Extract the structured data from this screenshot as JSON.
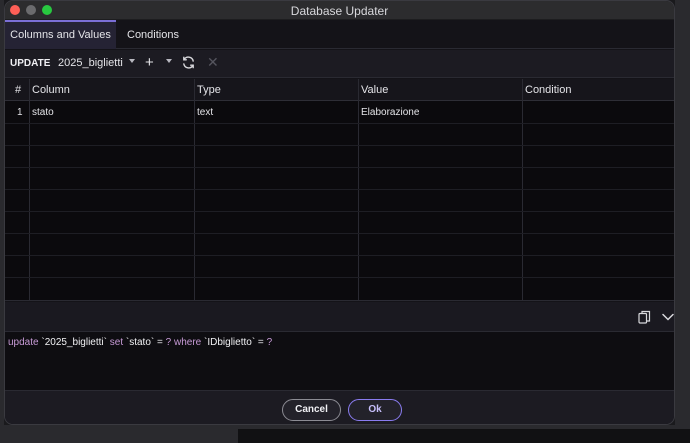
{
  "window": {
    "title": "Database Updater"
  },
  "tabs": [
    {
      "label": "Columns and Values",
      "active": true
    },
    {
      "label": "Conditions",
      "active": false
    }
  ],
  "toolbar": {
    "mode": "UPDATE",
    "table": "2025_biglietti",
    "add_icon": "plus-icon",
    "refresh_icon": "refresh-icon",
    "remove_icon": "close-icon"
  },
  "grid": {
    "headers": [
      "#",
      "Column",
      "Type",
      "Value",
      "Condition"
    ],
    "rows": [
      {
        "num": "1",
        "column": "stato",
        "type": "text",
        "value": "Elaborazione",
        "condition": ""
      }
    ]
  },
  "sql": {
    "copy_icon": "copy-icon",
    "collapse_icon": "chevron-down-icon",
    "tokens": [
      {
        "t": "update",
        "k": "kw"
      },
      {
        "t": " ",
        "k": ""
      },
      {
        "t": "`2025_biglietti`",
        "k": "id"
      },
      {
        "t": " ",
        "k": ""
      },
      {
        "t": "set",
        "k": "kw"
      },
      {
        "t": " ",
        "k": ""
      },
      {
        "t": "`stato`",
        "k": "id"
      },
      {
        "t": " = ",
        "k": ""
      },
      {
        "t": "?",
        "k": "kw"
      },
      {
        "t": " ",
        "k": ""
      },
      {
        "t": "where",
        "k": "kw"
      },
      {
        "t": " ",
        "k": ""
      },
      {
        "t": "`IDbiglietto`",
        "k": "id"
      },
      {
        "t": " = ",
        "k": ""
      },
      {
        "t": "?",
        "k": "kw"
      }
    ]
  },
  "buttons": {
    "cancel": "Cancel",
    "ok": "Ok"
  },
  "colors": {
    "accent": "#7b6fd6",
    "close": "#fe5f57",
    "maximize": "#28c840"
  }
}
